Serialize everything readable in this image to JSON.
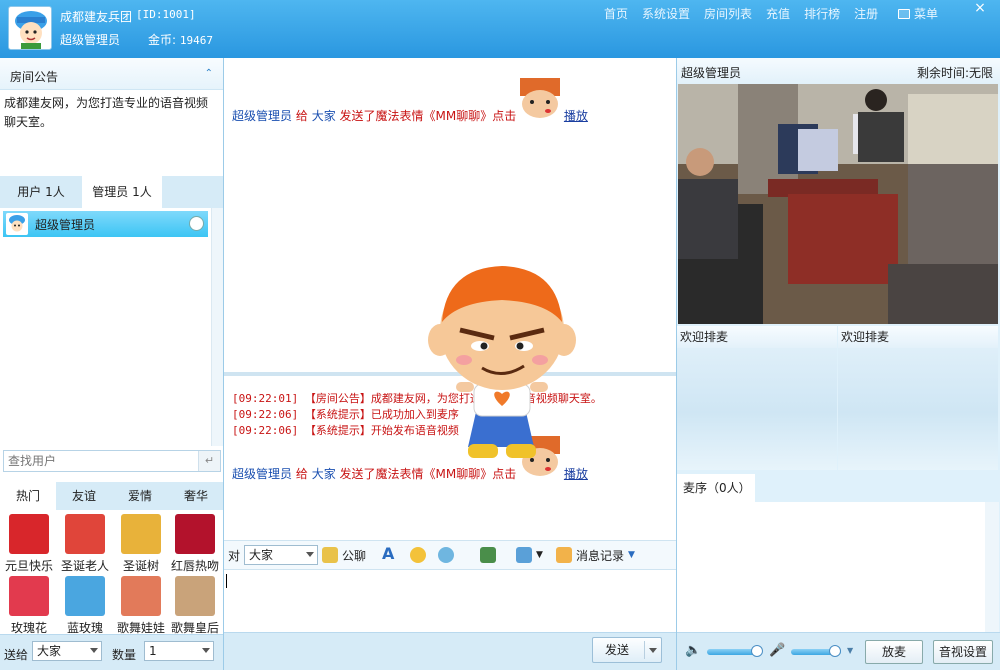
{
  "header": {
    "room_name": "成都建友兵团",
    "room_id": "[ID:1001]",
    "user_role": "超级管理员",
    "coins_label": "金币:",
    "coins_value": "19467",
    "nav": [
      "首页",
      "系统设置",
      "房间列表",
      "充值",
      "排行榜",
      "注册"
    ],
    "menu_label": "菜单",
    "close_glyph": "×"
  },
  "notice": {
    "title": "房间公告",
    "text": "成都建友网，为您打造专业的语音视频聊天室。"
  },
  "user_tabs": {
    "users": "用户 1人",
    "admins": "管理员 1人"
  },
  "user_list": [
    {
      "name": "超级管理员"
    }
  ],
  "search": {
    "placeholder": "查找用户"
  },
  "gift_tabs": [
    "热门",
    "友谊",
    "爱情",
    "奢华"
  ],
  "gifts": [
    {
      "name": "元旦快乐",
      "color": "#d8262b"
    },
    {
      "name": "圣诞老人",
      "color": "#e0453a"
    },
    {
      "name": "圣诞树",
      "color": "#e8b23a"
    },
    {
      "name": "红唇热吻",
      "color": "#b3122c"
    },
    {
      "name": "玫瑰花",
      "color": "#e23a4e"
    },
    {
      "name": "蓝玫瑰",
      "color": "#4aa6e0"
    },
    {
      "name": "歌舞娃娃",
      "color": "#e27a5a"
    },
    {
      "name": "歌舞皇后",
      "color": "#c9a37a"
    }
  ],
  "send_bar": {
    "to_label": "送给",
    "to_value": "大家",
    "qty_label": "数量",
    "qty_value": "1"
  },
  "chat_top": {
    "sender": "超级管理员",
    "give": "给",
    "target": "大家",
    "action": "发送了魔法表情《MM聊聊》点击",
    "play": "播放"
  },
  "system_messages": [
    {
      "time": "[09:22:01]",
      "text": "【房间公告】成都建友网，为您打造专业的语音视频聊天室。"
    },
    {
      "time": "[09:22:06]",
      "text": "【系统提示】已成功加入到麦序"
    },
    {
      "time": "[09:22:06]",
      "text": "【系统提示】开始发布语音视频"
    }
  ],
  "chat_bottom": {
    "sender": "超级管理员",
    "give": "给",
    "target": "大家",
    "action": "发送了魔法表情《MM聊聊》点击",
    "play": "播放"
  },
  "toolbar": {
    "to_label": "对",
    "to_value": "大家",
    "public_chat": "公聊",
    "history": "消息记录"
  },
  "send_button": "发送",
  "video": {
    "user": "超级管理员",
    "remaining": "剩余时间:无限"
  },
  "queue": {
    "slot1": "欢迎排麦",
    "slot2": "欢迎排麦"
  },
  "mic_order": {
    "label": "麦序（0人）"
  },
  "right_foot": {
    "release_mic": "放麦",
    "av_settings": "音视设置"
  },
  "colors": {
    "header_blue": "#2a97e0",
    "panel_blue": "#d6ebf7",
    "chat_red": "#c81414",
    "chat_blue": "#1a4fb0"
  }
}
